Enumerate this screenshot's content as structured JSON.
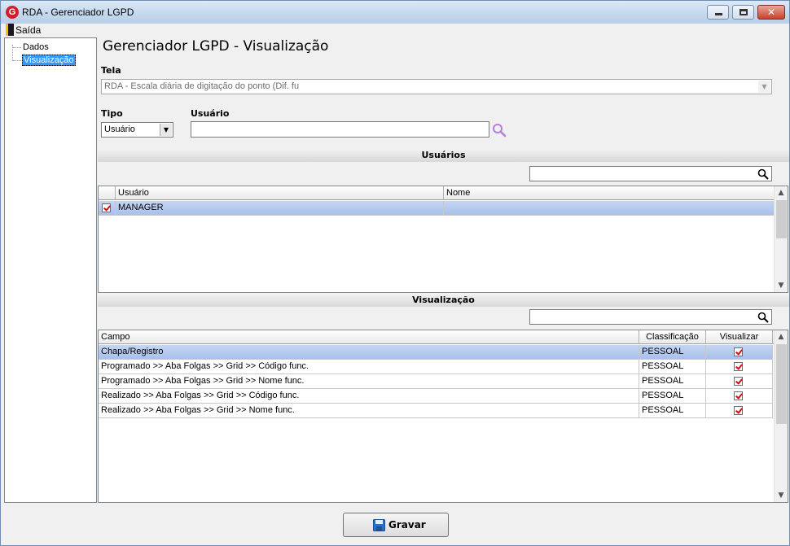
{
  "window": {
    "title": "RDA - Gerenciador LGPD",
    "app_icon_letter": "G"
  },
  "menu": {
    "exit_label": "Saída"
  },
  "tree": {
    "items": [
      "Dados",
      "Visualização"
    ],
    "selected": "Visualização"
  },
  "page": {
    "title": "Gerenciador LGPD - Visualização"
  },
  "form": {
    "tela_label": "Tela",
    "tela_value": "RDA - Escala diária de digitação do ponto (Dif. fu",
    "tipo_label": "Tipo",
    "tipo_value": "Usuário",
    "usuario_label": "Usuário",
    "usuario_value": ""
  },
  "users_section": {
    "title": "Usuários",
    "search_value": "",
    "columns": [
      "Usuário",
      "Nome"
    ],
    "rows": [
      {
        "checked": true,
        "usuario": "MANAGER",
        "nome": ""
      }
    ]
  },
  "view_section": {
    "title": "Visualização",
    "search_value": "",
    "columns": [
      "Campo",
      "Classificação",
      "Visualizar"
    ],
    "rows": [
      {
        "campo": "Chapa/Registro",
        "classificacao": "PESSOAL",
        "visualizar": true
      },
      {
        "campo": "Programado >> Aba Folgas >> Grid >> Código func.",
        "classificacao": "PESSOAL",
        "visualizar": true
      },
      {
        "campo": "Programado >> Aba Folgas >> Grid >> Nome func.",
        "classificacao": "PESSOAL",
        "visualizar": true
      },
      {
        "campo": "Realizado >> Aba Folgas >> Grid >> Código func.",
        "classificacao": "PESSOAL",
        "visualizar": true
      },
      {
        "campo": "Realizado >> Aba Folgas >> Grid >> Nome func.",
        "classificacao": "PESSOAL",
        "visualizar": true
      }
    ]
  },
  "actions": {
    "save_label": "Gravar"
  },
  "colors": {
    "selection": "#a8c0eb",
    "accent": "#d01f2a",
    "check": "#d01010"
  },
  "icons": [
    "app-logo-icon",
    "exit-door-icon",
    "search-icon",
    "magnifier-icon",
    "floppy-disk-icon",
    "checkbox-checked-icon"
  ]
}
